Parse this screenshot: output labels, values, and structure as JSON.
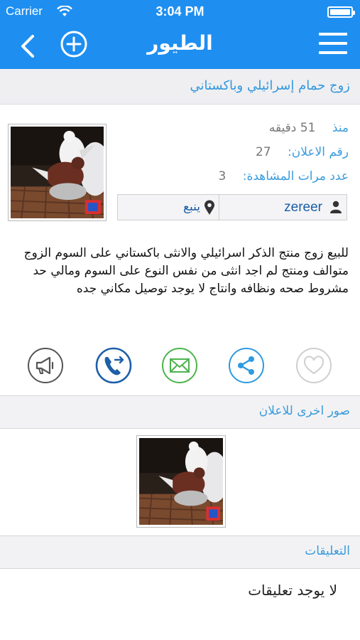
{
  "status_bar": {
    "carrier": "Carrier",
    "time": "3:04 PM"
  },
  "navbar": {
    "title": "الطيور"
  },
  "listing": {
    "title": "زوج حمام إسرائيلي وباكستاني",
    "since_label": "منذ",
    "since_value": "51 دقيقه",
    "ad_number_label": "رقم الاعلان:",
    "ad_number_value": "27",
    "views_label": "عدد مرات المشاهدة:",
    "views_value": "3",
    "username": "zereer",
    "location": "ينبع",
    "description": "للبيع زوج منتج الذكر اسرائيلي والانثى باكستاني على السوم الزوج متوالف ومنتج لم اجد انثى من نفس النوع على السوم ومالي حد مشروط صحه ونظافه وانتاج لا يوجد توصيل مكاني جده"
  },
  "actions": [
    {
      "name": "report-icon",
      "color": "#555555"
    },
    {
      "name": "call-icon",
      "color": "#1d5fa8"
    },
    {
      "name": "mail-icon",
      "color": "#4db34d"
    },
    {
      "name": "share-icon",
      "color": "#2e9ae0"
    },
    {
      "name": "favorite-icon",
      "color": "#cfcfcf"
    }
  ],
  "other_photos": {
    "heading": "صور اخرى للاعلان"
  },
  "comments": {
    "heading": "التعليقات",
    "empty_text": "لا يوجد تعليقات"
  },
  "colors": {
    "header_bg": "#1e8ff0",
    "accent": "#3a9bdc",
    "strip_bg": "#efeff2"
  }
}
